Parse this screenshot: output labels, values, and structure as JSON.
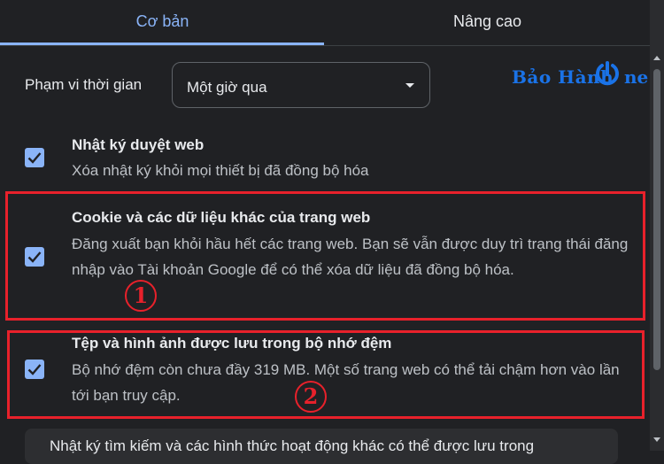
{
  "tabs": [
    {
      "label": "Cơ bản",
      "active": true
    },
    {
      "label": "Nâng cao",
      "active": false
    }
  ],
  "time_range": {
    "label": "Phạm vi thời gian",
    "selected": "Một giờ qua"
  },
  "watermark": {
    "text": "Bảo Hành",
    "suffix": "ne"
  },
  "items": [
    {
      "title": "Nhật ký duyệt web",
      "description": "Xóa nhật ký khỏi mọi thiết bị đã đồng bộ hóa",
      "checked": true
    },
    {
      "title": "Cookie và các dữ liệu khác của trang web",
      "description": "Đăng xuất bạn khỏi hầu hết các trang web. Bạn sẽ vẫn được duy trì trạng thái đăng nhập vào Tài khoản Google để có thể xóa dữ liệu đã đồng bộ hóa.",
      "checked": true,
      "annotation": "1"
    },
    {
      "title": "Tệp và hình ảnh được lưu trong bộ nhớ đệm",
      "description": "Bộ nhớ đệm còn chưa đầy 319 MB. Một số trang web có thể tải chậm hơn vào lần tới bạn truy cập.",
      "checked": true,
      "annotation": "2"
    }
  ],
  "bottom_notice": "Nhật ký tìm kiếm và các hình thức hoạt động khác có thể được lưu trong",
  "colors": {
    "accent": "#8ab4f8",
    "annotation_red": "#e8212b",
    "background": "#202124"
  }
}
